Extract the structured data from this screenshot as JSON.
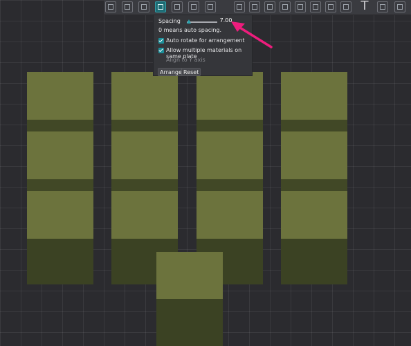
{
  "toolbar": {
    "icons": [
      "cube-icon",
      "grid-icon",
      "orient-icon",
      "arrange-icon",
      "layers-icon",
      "plus-icon",
      "move-icon",
      "rotate-icon",
      "scale-icon",
      "cut-icon",
      "support-icon",
      "seam-icon",
      "text-icon",
      "measure-icon",
      "assembly-icon",
      "text-tool-icon",
      "cut-tool-icon"
    ],
    "active_icon": "arrange-icon",
    "text_tool_glyph": "T"
  },
  "arrange_popup": {
    "spacing_label": "Spacing",
    "spacing_value": "7.00",
    "spacing_slider_fraction": 0.0,
    "hint": "0 means auto spacing.",
    "auto_rotate_label": "Auto rotate for arrangement",
    "auto_rotate_checked": true,
    "allow_materials_label": "Allow multiple materials on same plate",
    "allow_materials_checked": true,
    "align_y_label": "Align to Y axis",
    "arrange_button": "Arrange",
    "reset_button": "Reset"
  },
  "colors": {
    "background": "#2b2b2f",
    "object_light": "#6c733d",
    "object_dark": "#3b4223",
    "accent": "#2aa4b0",
    "annotation_arrow": "#ee1d7d"
  },
  "scene": {
    "columns": 4,
    "rows": 3,
    "extra_object_count": 1
  }
}
